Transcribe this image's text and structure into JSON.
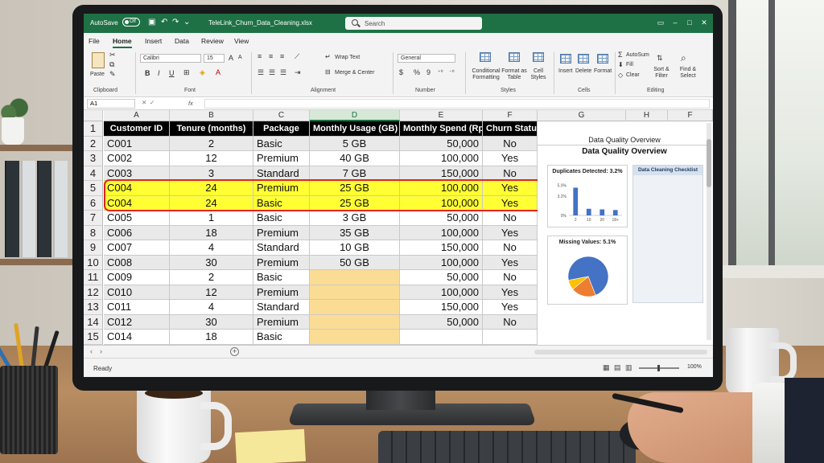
{
  "window": {
    "autosave_label": "AutoSave",
    "autosave_state": "Off",
    "filename": "TeleLink_Churn_Data_Cleaning.xlsx",
    "search_placeholder": "Search"
  },
  "menu": {
    "tabs": [
      "File",
      "Home",
      "Insert",
      "Data",
      "Review",
      "View"
    ],
    "active": "Home"
  },
  "ribbon": {
    "clipboard": {
      "label": "Clipboard",
      "paste": "Paste"
    },
    "font": {
      "label": "Font",
      "name": "Calibri",
      "size": "15",
      "bold": "B",
      "italic": "I",
      "underline": "U"
    },
    "alignment": {
      "label": "Alignment",
      "wrap_text": "Wrap Text",
      "merge_center": "Merge & Center"
    },
    "number": {
      "label": "Number",
      "format": "General",
      "currency": "$",
      "percent": "%",
      "comma": "9"
    },
    "styles": {
      "label": "Styles",
      "conditional_formatting": "Conditional Formatting",
      "format_as_table": "Format as Table",
      "cell_styles": "Cell Styles"
    },
    "cells": {
      "label": "Cells",
      "insert": "Insert",
      "delete": "Delete",
      "format": "Format"
    },
    "editing": {
      "label": "Editing",
      "autosum": "AutoSum",
      "fill": "Fill",
      "clear": "Clear",
      "sort_filter": "Sort & Filter",
      "find_select": "Find & Select"
    }
  },
  "formula_bar": {
    "name_box": "A1",
    "fx": "fx"
  },
  "grid": {
    "columns": [
      "A",
      "B",
      "C",
      "D",
      "E",
      "F",
      "G",
      "H",
      "F"
    ],
    "selected_column": "D",
    "header_row": [
      "Customer ID",
      "Tenure (months)",
      "Package",
      "Monthly Usage (GB)",
      "Monthly Spend (Rp)",
      "Churn Status"
    ],
    "rows": [
      {
        "n": "2",
        "id": "C001",
        "tenure": "2",
        "pkg": "Basic",
        "usage": "5 GB",
        "spend": "50,000",
        "churn": "No"
      },
      {
        "n": "3",
        "id": "C002",
        "tenure": "12",
        "pkg": "Premium",
        "usage": "40 GB",
        "spend": "100,000",
        "churn": "Yes"
      },
      {
        "n": "4",
        "id": "C003",
        "tenure": "3",
        "pkg": "Standard",
        "usage": "7 GB",
        "spend": "150,000",
        "churn": "No"
      },
      {
        "n": "5",
        "id": "C004",
        "tenure": "24",
        "pkg": "Premium",
        "usage": "25 GB",
        "spend": "100,000",
        "churn": "Yes"
      },
      {
        "n": "6",
        "id": "C004",
        "tenure": "24",
        "pkg": "Basic",
        "usage": "25 GB",
        "spend": "100,000",
        "churn": "Yes"
      },
      {
        "n": "7",
        "id": "C005",
        "tenure": "1",
        "pkg": "Basic",
        "usage": "3 GB",
        "spend": "50,000",
        "churn": "No"
      },
      {
        "n": "8",
        "id": "C006",
        "tenure": "18",
        "pkg": "Premium",
        "usage": "35 GB",
        "spend": "100,000",
        "churn": "Yes"
      },
      {
        "n": "9",
        "id": "C007",
        "tenure": "4",
        "pkg": "Standard",
        "usage": "10 GB",
        "spend": "150,000",
        "churn": "No"
      },
      {
        "n": "10",
        "id": "C008",
        "tenure": "30",
        "pkg": "Premium",
        "usage": "50 GB",
        "spend": "100,000",
        "churn": "Yes"
      },
      {
        "n": "11",
        "id": "C009",
        "tenure": "2",
        "pkg": "Basic",
        "usage": "",
        "spend": "50,000",
        "churn": "No"
      },
      {
        "n": "12",
        "id": "C010",
        "tenure": "12",
        "pkg": "Premium",
        "usage": "",
        "spend": "100,000",
        "churn": "Yes"
      },
      {
        "n": "13",
        "id": "C011",
        "tenure": "4",
        "pkg": "Standard",
        "usage": "",
        "spend": "150,000",
        "churn": "Yes"
      },
      {
        "n": "14",
        "id": "C012",
        "tenure": "30",
        "pkg": "Premium",
        "usage": "",
        "spend": "50,000",
        "churn": "No"
      },
      {
        "n": "15",
        "id": "C014",
        "tenure": "18",
        "pkg": "Basic",
        "usage": "",
        "spend": "",
        "churn": ""
      }
    ]
  },
  "dq_panel": {
    "cell_title": "Data Quality Overview",
    "title": "Data Quality Overview",
    "duplicates_title": "Duplicates Detected: 3.2%",
    "missing_title": "Missing Values: 5.1%",
    "checklist_title": "Data Cleaning Checklist"
  },
  "chart_data": [
    {
      "type": "bar",
      "title": "Duplicates Detected: 3.2%",
      "categories": [
        "2",
        "10",
        "20",
        "18+"
      ],
      "values": [
        4.6,
        1.1,
        1.0,
        0.9
      ],
      "ylim": [
        0,
        5.6
      ],
      "yticks": [
        "5.0%",
        "3.2%",
        "0%"
      ],
      "color": "#4472c4"
    },
    {
      "type": "pie",
      "title": "Missing Values: 5.1%",
      "values": [
        0.72,
        0.2,
        0.08
      ],
      "colors": [
        "#4472c4",
        "#ed7d31",
        "#ffc000"
      ]
    }
  ],
  "status": {
    "ready": "Ready",
    "zoom": "100%"
  },
  "colors": {
    "excel_green": "#1e7145",
    "duplicate_yellow": "#ffff33",
    "missing_orange": "#fbdc95",
    "outline_red": "#e2231a"
  }
}
